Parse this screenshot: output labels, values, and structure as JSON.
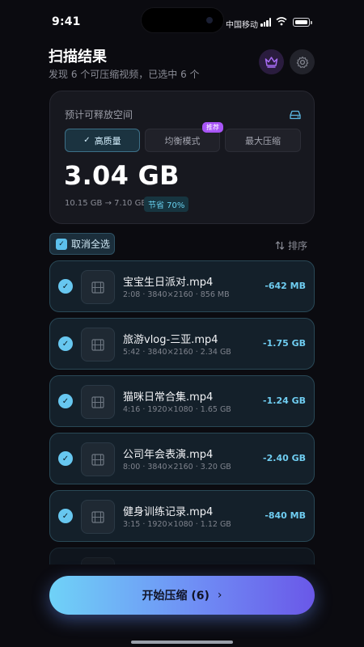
{
  "status": {
    "time": "9:41",
    "carrier": "中国移动"
  },
  "header": {
    "title": "扫描结果",
    "subtitle": "发现 6 个可压缩视频，已选中 6 个"
  },
  "space_card": {
    "label": "预计可释放空间",
    "modes": [
      "高质量",
      "均衡模式",
      "最大压缩"
    ],
    "active_mode": "高质量",
    "recommended_badge": "推荐",
    "savings_size": "3.04 GB",
    "size_change": "10.15 GB → 7.10 GB",
    "save_badge": "节省 70%"
  },
  "list_controls": {
    "deselect_all": "取消全选",
    "sort": "排序"
  },
  "videos": [
    {
      "name": "宝宝生日派对.mp4",
      "meta": "2:08 · 3840×2160 · 856 MB",
      "saving": "-642 MB"
    },
    {
      "name": "旅游vlog-三亚.mp4",
      "meta": "5:42 · 3840×2160 · 2.34 GB",
      "saving": "-1.75 GB"
    },
    {
      "name": "猫咪日常合集.mp4",
      "meta": "4:16 · 1920×1080 · 1.65 GB",
      "saving": "-1.24 GB"
    },
    {
      "name": "公司年会表演.mp4",
      "meta": "8:00 · 3840×2160 · 3.20 GB",
      "saving": "-2.40 GB"
    },
    {
      "name": "健身训练记录.mp4",
      "meta": "3:15 · 1920×1080 · 1.12 GB",
      "saving": "-840 MB"
    }
  ],
  "start_button": "开始压缩 (6)",
  "icons": {
    "crown": "crown-icon",
    "gear": "gear-icon",
    "drive": "hard-drive-icon",
    "video": "film-icon",
    "check": "check-icon",
    "sort": "sort-arrows-icon",
    "chevron": "chevron-right-icon"
  }
}
